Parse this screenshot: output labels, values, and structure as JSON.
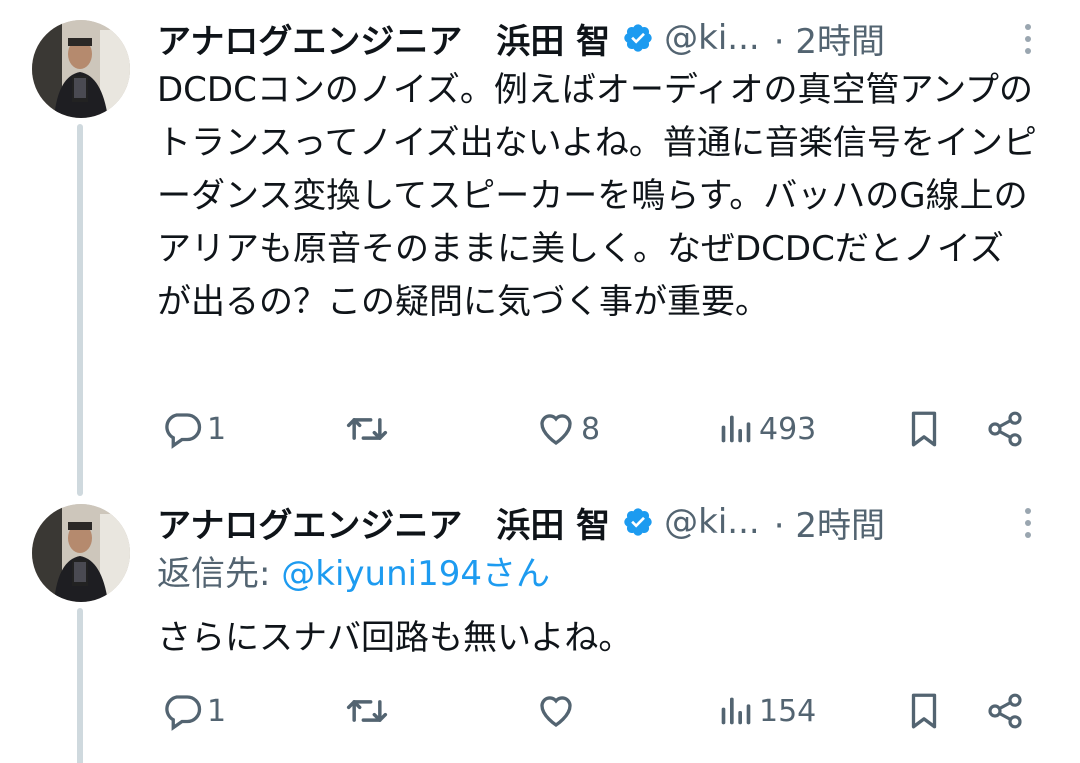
{
  "tweets": [
    {
      "author_name": "アナログエンジニア　浜田 智",
      "handle": "@ki...",
      "time": "· 2時間",
      "text": "DCDCコンのノイズ。例えばオーディオの真空管アンプのトランスってノイズ出ないよね。普通に音楽信号をインピーダンス変換してスピーカーを鳴らす。バッハのG線上のアリアも原音そのままに美しく。なぜDCDCだとノイズが出るの？この疑問に気づく事が重要。",
      "reply_count": "1",
      "retweet_count": "",
      "like_count": "8",
      "view_count": "493"
    },
    {
      "author_name": "アナログエンジニア　浜田 智",
      "handle": "@ki...",
      "time": "· 2時間",
      "reply_to_label": "返信先: ",
      "reply_to_handle": "@kiyuni194さん",
      "text": "さらにスナバ回路も無いよね。",
      "reply_count": "1",
      "retweet_count": "",
      "like_count": "",
      "view_count": "154"
    }
  ],
  "icons": {
    "reply": "reply-icon",
    "retweet": "retweet-icon",
    "like": "heart-icon",
    "views": "views-icon",
    "bookmark": "bookmark-icon",
    "share": "share-icon",
    "verified": "verified-badge-icon",
    "more": "more-icon"
  },
  "colors": {
    "verified_blue": "#1d9bf0",
    "mention_blue": "#1d9bf0",
    "secondary_text": "#536471",
    "thread_line": "#cfd9de"
  }
}
